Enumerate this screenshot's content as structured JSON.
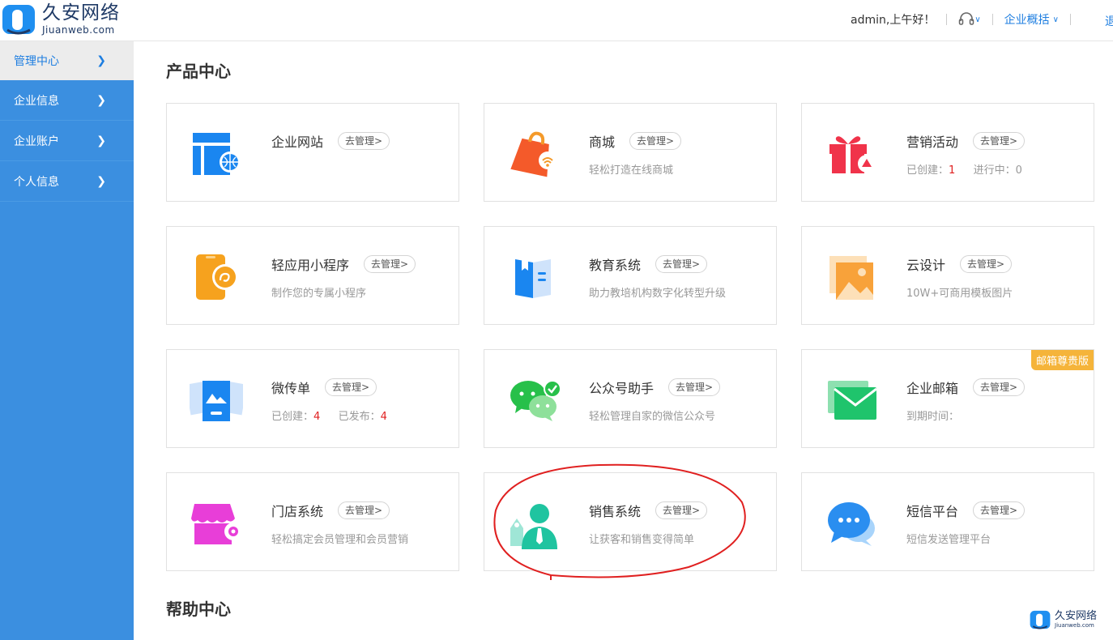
{
  "brand": {
    "name_cn": "久安网络",
    "name_en": "Jiuanweb.com"
  },
  "header": {
    "greeting": "admin,上午好！",
    "overview": "企业概括",
    "logout": "退出"
  },
  "sidebar": {
    "items": [
      {
        "label": "管理中心",
        "active": true
      },
      {
        "label": "企业信息"
      },
      {
        "label": "企业账户"
      },
      {
        "label": "个人信息"
      }
    ]
  },
  "product_center": {
    "title": "产品中心",
    "manage": "去管理>",
    "cards": [
      {
        "title": "企业网站"
      },
      {
        "title": "商城",
        "desc": "轻松打造在线商城"
      },
      {
        "title": "营销活动",
        "created_label": "已创建：",
        "created": "1",
        "running_label": "进行中：",
        "running": "0"
      },
      {
        "title": "轻应用小程序",
        "desc": "制作您的专属小程序"
      },
      {
        "title": "教育系统",
        "desc": "助力教培机构数字化转型升级"
      },
      {
        "title": "云设计",
        "desc": "10W+可商用模板图片"
      },
      {
        "title": "微传单",
        "created_label": "已创建：",
        "created": "4",
        "published_label": "已发布：",
        "published": "4"
      },
      {
        "title": "公众号助手",
        "desc": "轻松管理自家的微信公众号"
      },
      {
        "title": "企业邮箱",
        "desc": "到期时间：",
        "badge": "邮箱尊贵版"
      },
      {
        "title": "门店系统",
        "desc": "轻松搞定会员管理和会员营销"
      },
      {
        "title": "销售系统",
        "desc": "让获客和销售变得简单"
      },
      {
        "title": "短信平台",
        "desc": "短信发送管理平台"
      }
    ]
  },
  "help_center": {
    "title": "帮助中心"
  },
  "colors": {
    "sidebar": "#3b8fe0",
    "accent": "#1e7ee0",
    "highlight": "#e02020"
  }
}
